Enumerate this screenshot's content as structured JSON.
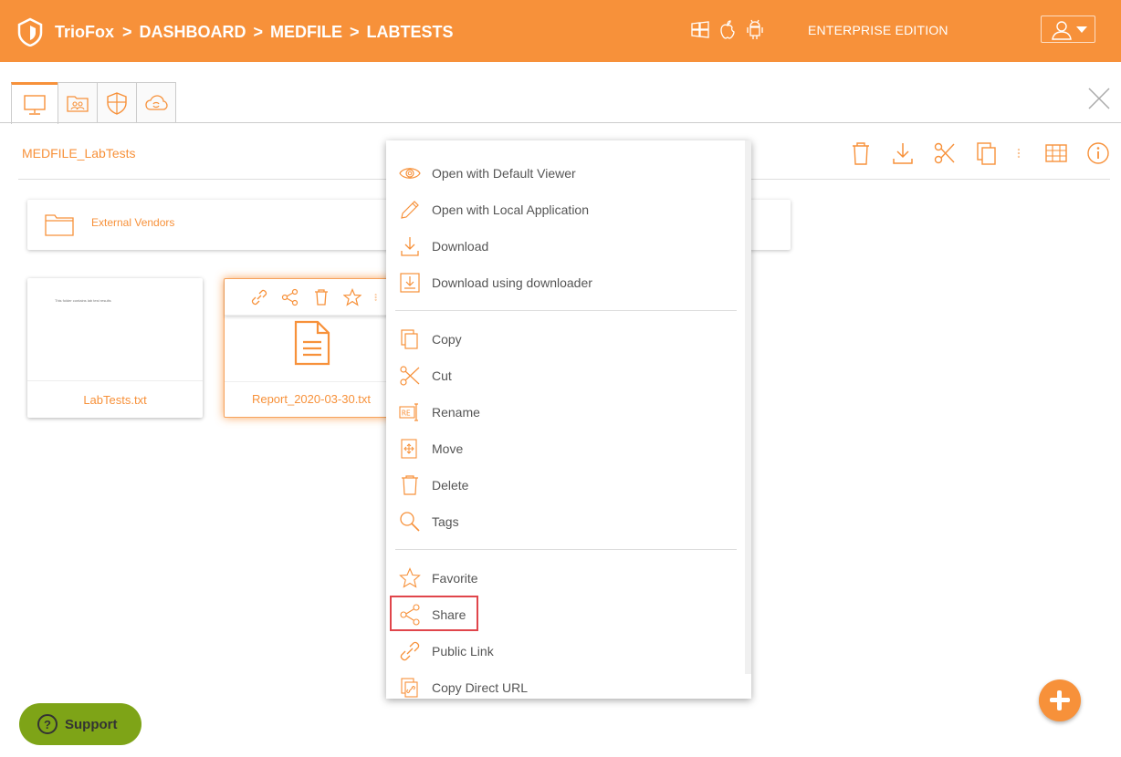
{
  "header": {
    "brand": "TrioFox",
    "breadcrumbs": [
      {
        "sep": ">",
        "label": "DASHBOARD"
      },
      {
        "sep": ">",
        "label": "MEDFILE"
      },
      {
        "sep": ">",
        "label": "LABTESTS"
      }
    ],
    "platform_icons": [
      "windows-icon",
      "apple-icon",
      "android-icon"
    ],
    "edition": "ENTERPRISE EDITION",
    "user_menu_icon": "user-icon"
  },
  "tabs": [
    {
      "icon": "monitor-icon",
      "active": true
    },
    {
      "icon": "shared-folder-icon",
      "active": false
    },
    {
      "icon": "shield-icon",
      "active": false
    },
    {
      "icon": "cloud-sync-icon",
      "active": false
    }
  ],
  "content": {
    "folder_title": "MEDFILE_LabTests",
    "toolbar_icons": [
      "trash-icon",
      "download-icon",
      "scissors-icon",
      "copy-icon",
      "more-vertical-icon",
      "grid-view-icon",
      "info-icon"
    ],
    "folders": [
      {
        "name": "External Vendors"
      }
    ],
    "files": [
      {
        "name": "LabTests.txt",
        "preview_text": "This folder contains lab test results"
      },
      {
        "name": "Report_2020-03-30.txt"
      }
    ]
  },
  "context_menu": {
    "groups": [
      [
        {
          "label": "Open with Default Viewer",
          "icon": "eye-icon"
        },
        {
          "label": "Open with Local Application",
          "icon": "pencil-icon"
        },
        {
          "label": "Download",
          "icon": "download-icon"
        },
        {
          "label": "Download using downloader",
          "icon": "download-box-icon"
        }
      ],
      [
        {
          "label": "Copy",
          "icon": "copy-icon"
        },
        {
          "label": "Cut",
          "icon": "scissors-icon"
        },
        {
          "label": "Rename",
          "icon": "rename-icon"
        },
        {
          "label": "Move",
          "icon": "move-icon"
        },
        {
          "label": "Delete",
          "icon": "trash-icon"
        },
        {
          "label": "Tags",
          "icon": "search-icon"
        }
      ],
      [
        {
          "label": "Favorite",
          "icon": "star-icon"
        },
        {
          "label": "Share",
          "icon": "share-icon",
          "highlighted": true
        },
        {
          "label": "Public Link",
          "icon": "link-icon"
        },
        {
          "label": "Copy Direct URL",
          "icon": "copy-link-icon"
        }
      ]
    ]
  },
  "support": {
    "label": "Support",
    "icon_text": "?"
  },
  "fab_icon": "plus-icon",
  "colors": {
    "accent": "#f7913a",
    "support_green": "#7ea417",
    "highlight_red": "#e0454b"
  }
}
